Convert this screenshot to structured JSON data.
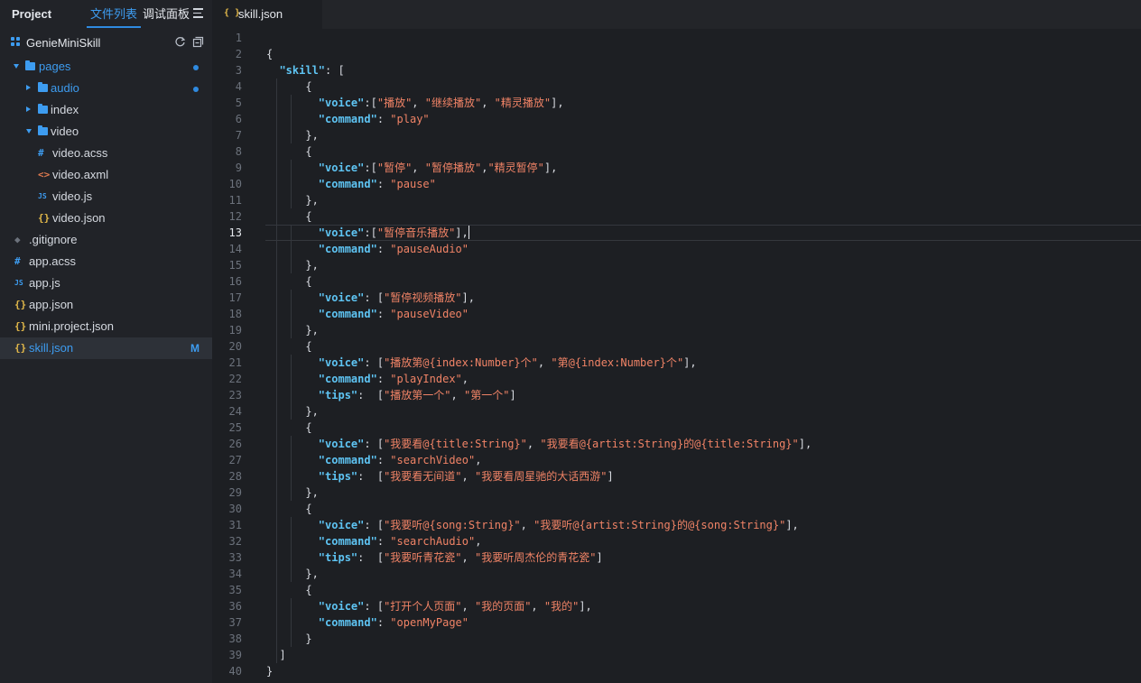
{
  "sidebar": {
    "tabs": {
      "project": "Project",
      "files": "文件列表",
      "debug": "调试面板"
    },
    "project_name": "GenieMiniSkill",
    "tree": [
      {
        "label": "pages",
        "kind": "folder-open",
        "depth": 0,
        "dot": true
      },
      {
        "label": "audio",
        "kind": "folder-closed",
        "depth": 1,
        "dot": true
      },
      {
        "label": "index",
        "kind": "folder-closed",
        "depth": 1
      },
      {
        "label": "video",
        "kind": "folder-open",
        "depth": 1
      },
      {
        "label": "video.acss",
        "kind": "file-css",
        "icon": "#"
      },
      {
        "label": "video.axml",
        "kind": "file-xml",
        "icon": "<>"
      },
      {
        "label": "video.js",
        "kind": "file-js",
        "icon": "JS"
      },
      {
        "label": "video.json",
        "kind": "file-json",
        "icon": "{}"
      },
      {
        "label": ".gitignore",
        "kind": "file-git",
        "icon": "◆"
      },
      {
        "label": "app.acss",
        "kind": "file-css",
        "icon": "#"
      },
      {
        "label": "app.js",
        "kind": "file-js",
        "icon": "JS"
      },
      {
        "label": "app.json",
        "kind": "file-json",
        "icon": "{}"
      },
      {
        "label": "mini.project.json",
        "kind": "file-json",
        "icon": "{}"
      },
      {
        "label": "skill.json",
        "kind": "file-json",
        "icon": "{}",
        "selected": true,
        "badge": "M"
      }
    ]
  },
  "editor": {
    "tab_label": "skill.json",
    "current_line": 13,
    "lines": [
      "",
      "{",
      "  \"skill\": [",
      "      {",
      "        \"voice\":[\"播放\", \"继续播放\", \"精灵播放\"],",
      "        \"command\": \"play\"",
      "      },",
      "      {",
      "        \"voice\":[\"暂停\", \"暂停播放\",\"精灵暂停\"],",
      "        \"command\": \"pause\"",
      "      },",
      "      {",
      "        \"voice\":[\"暂停音乐播放\"],",
      "        \"command\": \"pauseAudio\"",
      "      },",
      "      {",
      "        \"voice\": [\"暂停视频播放\"],",
      "        \"command\": \"pauseVideo\"",
      "      },",
      "      {",
      "        \"voice\": [\"播放第@{index:Number}个\", \"第@{index:Number}个\"],",
      "        \"command\": \"playIndex\",",
      "        \"tips\":  [\"播放第一个\", \"第一个\"]",
      "      },",
      "      {",
      "        \"voice\": [\"我要看@{title:String}\", \"我要看@{artist:String}的@{title:String}\"],",
      "        \"command\": \"searchVideo\",",
      "        \"tips\":  [\"我要看无间道\", \"我要看周星驰的大话西游\"]",
      "      },",
      "      {",
      "        \"voice\": [\"我要听@{song:String}\", \"我要听@{artist:String}的@{song:String}\"],",
      "        \"command\": \"searchAudio\",",
      "        \"tips\":  [\"我要听青花瓷\", \"我要听周杰伦的青花瓷\"]",
      "      },",
      "      {",
      "        \"voice\": [\"打开个人页面\", \"我的页面\", \"我的\"],",
      "        \"command\": \"openMyPage\"",
      "      }",
      "  ]",
      "}"
    ]
  },
  "colors": {
    "accent": "#3d9cf0",
    "key": "#5ec4f3",
    "string": "#f08366",
    "json_icon": "#e3b94a"
  }
}
